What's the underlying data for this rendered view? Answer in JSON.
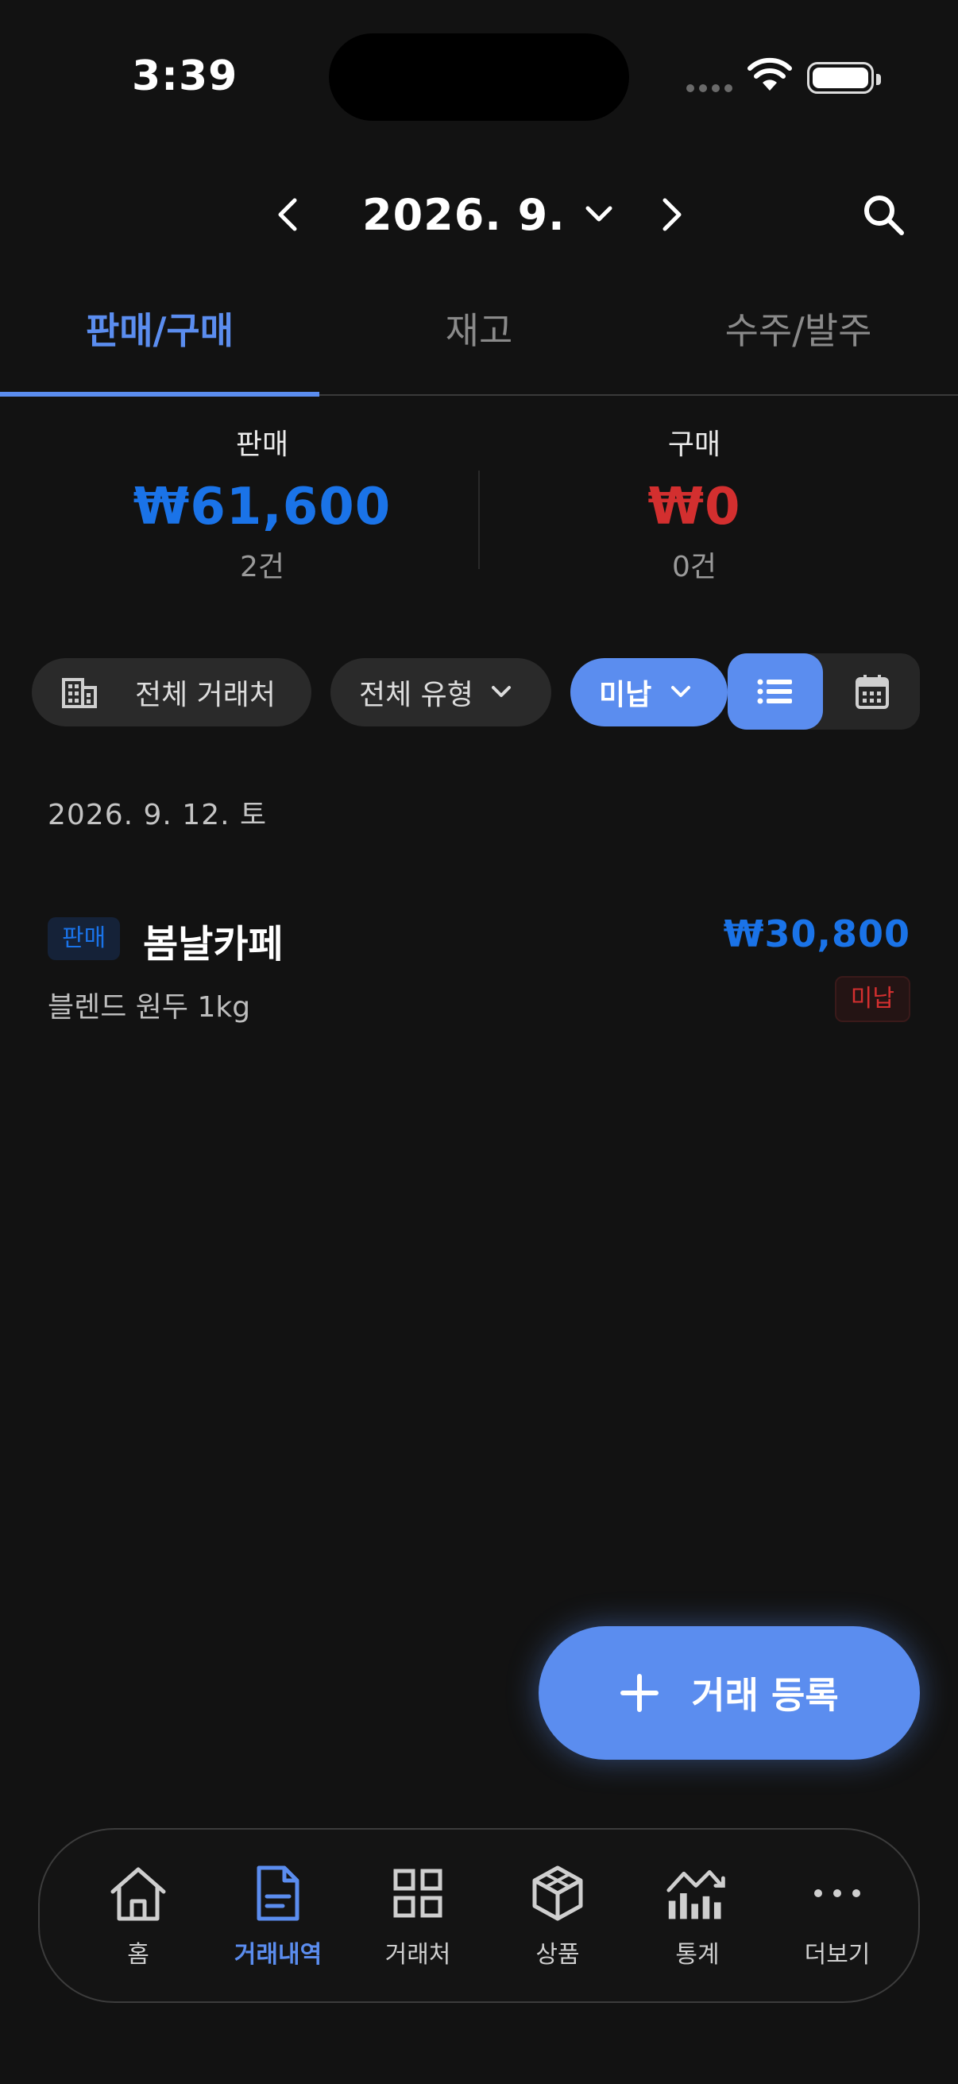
{
  "status_bar": {
    "time": "3:39"
  },
  "header": {
    "month": "2026. 9."
  },
  "tabs": [
    {
      "label": "판매/구매",
      "active": true
    },
    {
      "label": "재고",
      "active": false
    },
    {
      "label": "수주/발주",
      "active": false
    }
  ],
  "summary": {
    "sales": {
      "label": "판매",
      "amount": "₩61,600",
      "count": "2건"
    },
    "purchase": {
      "label": "구매",
      "amount": "₩0",
      "count": "0건"
    }
  },
  "filters": {
    "partner": "전체 거래처",
    "type": "전체 유형",
    "status": "미납"
  },
  "list": {
    "date_header": "2026. 9. 12. 토",
    "transactions": [
      {
        "badge": "판매",
        "name": "봄날카페",
        "amount": "₩30,800",
        "description": "블렌드 원두 1kg",
        "status": "미납"
      }
    ]
  },
  "fab": {
    "label": "거래 등록"
  },
  "bottom_nav": {
    "items": [
      {
        "label": "홈",
        "icon": "home-icon"
      },
      {
        "label": "거래내역",
        "icon": "document-icon",
        "active": true
      },
      {
        "label": "거래처",
        "icon": "grid-icon"
      },
      {
        "label": "상품",
        "icon": "cube-icon"
      },
      {
        "label": "통계",
        "icon": "chart-icon"
      },
      {
        "label": "더보기",
        "icon": "more-icon"
      }
    ]
  },
  "colors": {
    "accent": "#5b8def",
    "sales": "#1a73e8",
    "purchase": "#d32f2f",
    "background": "#121212"
  }
}
